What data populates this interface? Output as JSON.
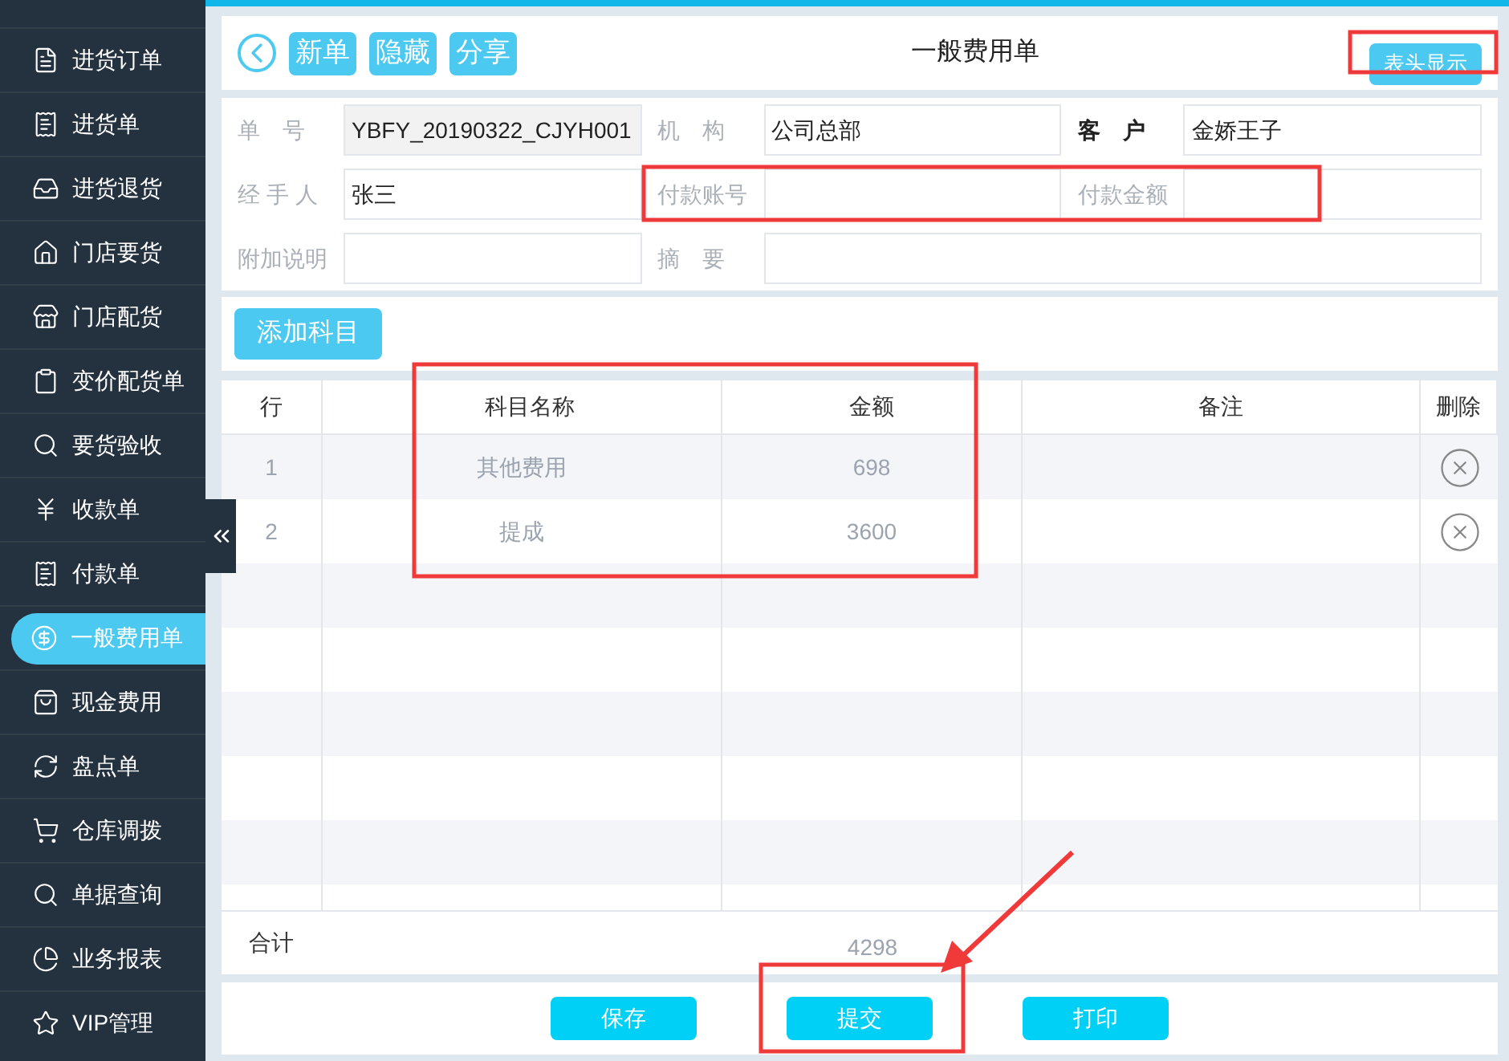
{
  "sidebar": {
    "items": [
      {
        "label": "进货订单",
        "selected": false
      },
      {
        "label": "进货单",
        "selected": false
      },
      {
        "label": "进货退货",
        "selected": false
      },
      {
        "label": "门店要货",
        "selected": false
      },
      {
        "label": "门店配货",
        "selected": false
      },
      {
        "label": "变价配货单",
        "selected": false
      },
      {
        "label": "要货验收",
        "selected": false
      },
      {
        "label": "收款单",
        "selected": false
      },
      {
        "label": "付款单",
        "selected": false
      },
      {
        "label": "一般费用单",
        "selected": true
      },
      {
        "label": "现金费用",
        "selected": false
      },
      {
        "label": "盘点单",
        "selected": false
      },
      {
        "label": "仓库调拨",
        "selected": false
      },
      {
        "label": "单据查询",
        "selected": false
      },
      {
        "label": "业务报表",
        "selected": false
      },
      {
        "label": "VIP管理",
        "selected": false
      }
    ]
  },
  "toolbar": {
    "buttons": [
      "新单",
      "隐藏",
      "分享"
    ],
    "title": "一般费用单",
    "toggle": "表头显示"
  },
  "form": {
    "rows": [
      [
        {
          "label": "单　号",
          "value": "YBFY_20190322_CJYH001",
          "kind": "readonly",
          "bold": false
        },
        {
          "label": "机　构",
          "value": "公司总部",
          "kind": "input",
          "bold": false
        },
        {
          "label": "客　户",
          "value": "金娇王子",
          "kind": "input",
          "bold": true
        }
      ],
      [
        {
          "label": "经 手 人",
          "value": "张三",
          "kind": "input",
          "bold": false
        },
        {
          "label": "付款账号",
          "kind": "input",
          "bold": false
        },
        {
          "label": "付款金额",
          "kind": "input",
          "bold": false
        }
      ],
      [
        {
          "label": "附加说明",
          "kind": "input",
          "bold": false
        },
        {
          "label": "摘　要",
          "kind": "wide",
          "bold": false
        }
      ]
    ]
  },
  "add_button": "添加科目",
  "table": {
    "columns": [
      "行",
      "科目名称",
      "金额",
      "备注",
      "删除"
    ],
    "rows": [
      {
        "row": "1",
        "name": "其他费用",
        "amount": "698"
      },
      {
        "row": "2",
        "name": "提成",
        "amount": "3600"
      }
    ],
    "total_label": "合计",
    "total": "4298"
  },
  "actions": [
    "保存",
    "提交",
    "打印"
  ]
}
